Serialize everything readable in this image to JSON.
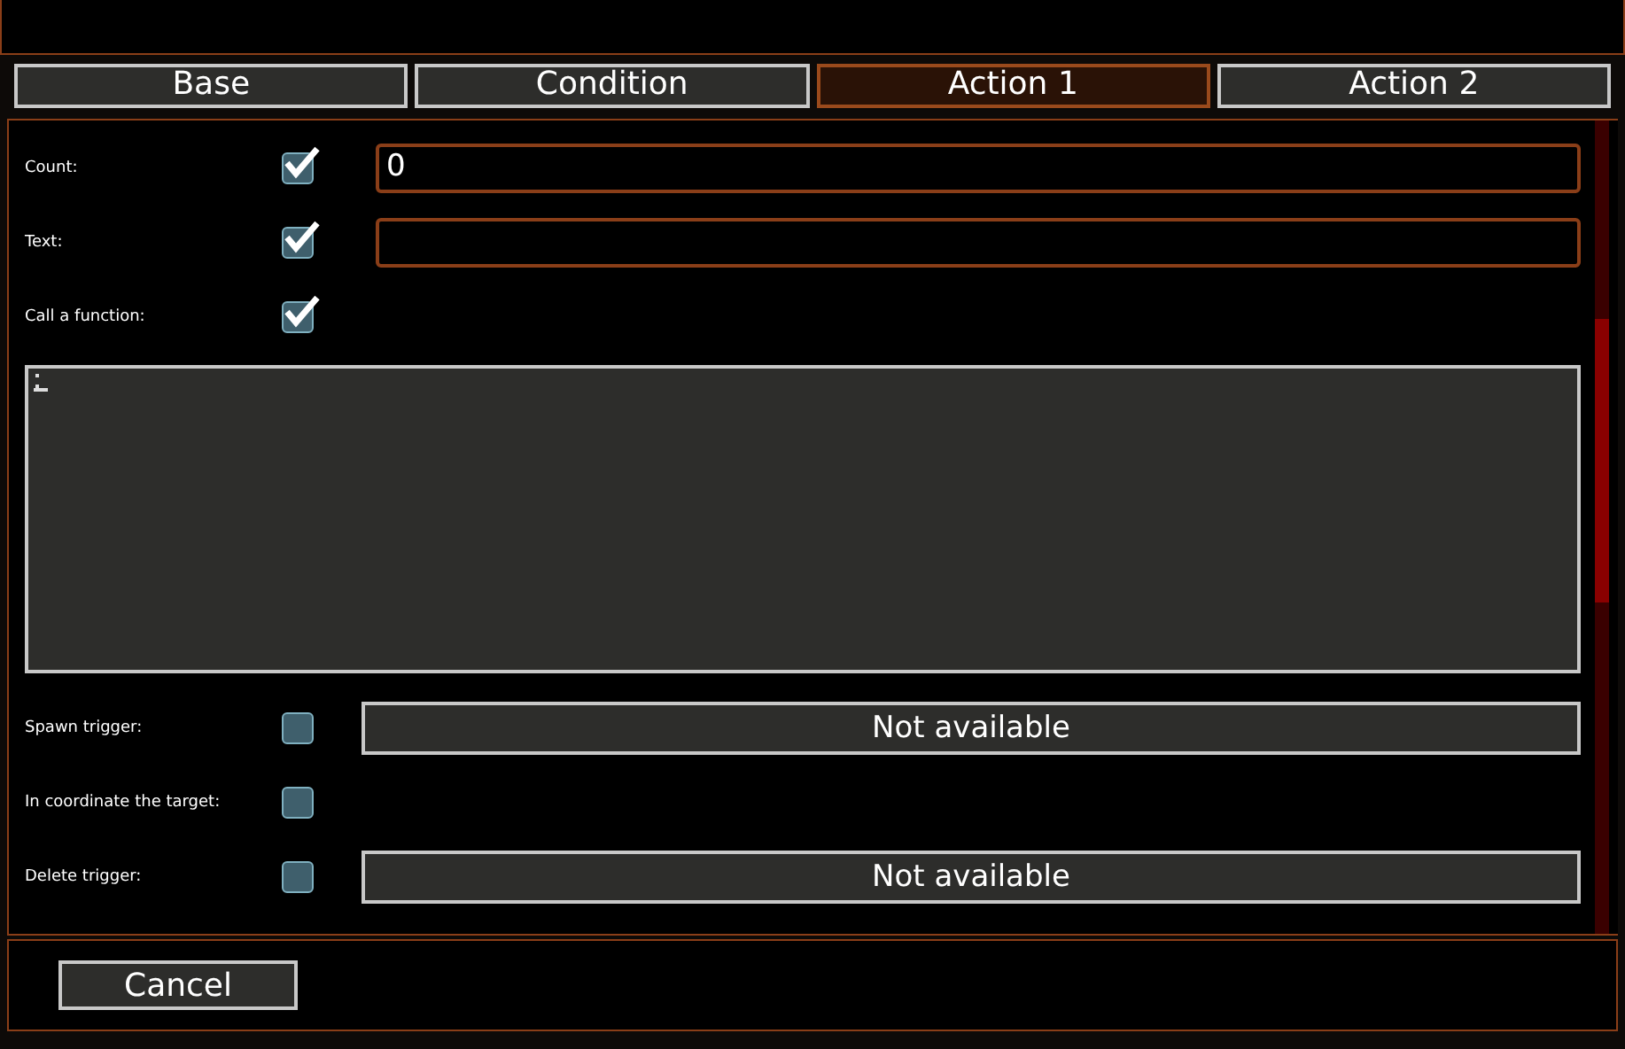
{
  "tabs": [
    {
      "label": "Base",
      "selected": false
    },
    {
      "label": "Condition",
      "selected": false
    },
    {
      "label": "Action 1",
      "selected": true
    },
    {
      "label": "Action 2",
      "selected": false
    }
  ],
  "rows": [
    {
      "kind": "input",
      "label": "Count:",
      "checked": true,
      "value": "0"
    },
    {
      "kind": "input",
      "label": "Text:",
      "checked": true,
      "value": ""
    },
    {
      "kind": "plain",
      "label": "Call a function:",
      "checked": true
    },
    {
      "kind": "code"
    },
    {
      "kind": "status",
      "label": "Spawn trigger:",
      "checked": false,
      "status": "Not available"
    },
    {
      "kind": "plain",
      "label": "In coordinate the target:",
      "checked": false
    },
    {
      "kind": "status",
      "label": "Delete trigger:",
      "checked": false,
      "status": "Not available"
    }
  ],
  "buttons": [
    "Cancel"
  ]
}
